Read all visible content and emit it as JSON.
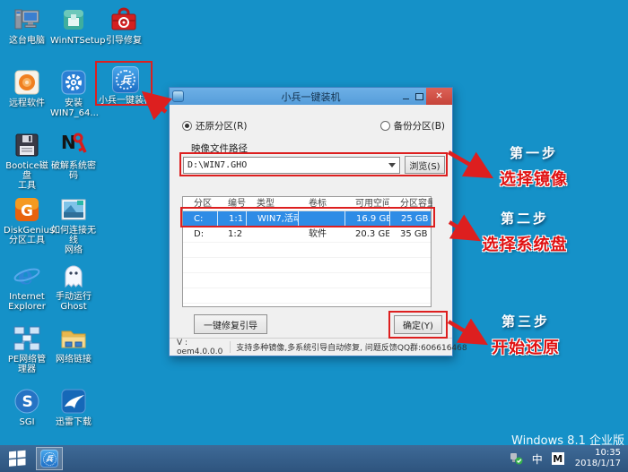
{
  "colors": {
    "desktop": "#1591c8",
    "taskbar": "#33587f",
    "titlebar": "#5ea3de",
    "highlight_red": "#dd1f1f",
    "selection_blue": "#2e8ce6"
  },
  "desktop": {
    "icons": [
      {
        "label": "这台电脑",
        "icon": "computer-icon"
      },
      {
        "label": "WinNTSetup",
        "icon": "package-icon"
      },
      {
        "label": "引导修复",
        "icon": "toolbox-icon"
      },
      {
        "label": "远程软件",
        "icon": "remote-icon"
      },
      {
        "label": "安装\nWIN7_64...",
        "icon": "gear-icon"
      },
      {
        "label": "小兵一键装机",
        "icon": "xiaobing-icon"
      },
      {
        "label": "Bootice磁盘\n工具",
        "icon": "floppy-icon"
      },
      {
        "label": "破解系统密码",
        "icon": "key-icon"
      },
      {
        "label": "DiskGenius\n分区工具",
        "icon": "diskgenius-icon"
      },
      {
        "label": "如何连接无线\n网络",
        "icon": "picture-icon"
      },
      {
        "label": "Internet\nExplorer",
        "icon": "ie-icon"
      },
      {
        "label": "手动运行\nGhost",
        "icon": "ghost-icon"
      },
      {
        "label": "PE网络管理器",
        "icon": "network-icon"
      },
      {
        "label": "网络链接",
        "icon": "folder-network-icon"
      },
      {
        "label": "SGI",
        "icon": "sgi-icon"
      },
      {
        "label": "迅雷下载",
        "icon": "thunder-icon"
      }
    ],
    "watermark": "Windows 8.1 企业版"
  },
  "dialog": {
    "title": "小兵一键装机",
    "radio_restore": "还原分区(R)",
    "radio_backup": "备份分区(B)",
    "path_label": "映像文件路径",
    "path_value": "D:\\WIN7.GHO",
    "browse_button": "浏览(S)",
    "table": {
      "headers": [
        "分区",
        "编号",
        "类型",
        "卷标",
        "可用空间",
        "分区容量"
      ],
      "rows": [
        {
          "selected": true,
          "cells": [
            "C:",
            "1:1",
            "WIN7,活动",
            "",
            "16.9 GB",
            "25 GB"
          ]
        },
        {
          "selected": false,
          "cells": [
            "D:",
            "1:2",
            "",
            "软件",
            "20.3 GB",
            "35 GB"
          ]
        }
      ]
    },
    "repair_button": "一键修复引导",
    "ok_button": "确定(Y)",
    "version": "V : oem4.0.0.0",
    "status": "支持多种镜像,多系统引导自动修复, 问题反馈QQ群:606616468"
  },
  "annotations": [
    {
      "step": "第一步",
      "action": "选择镜像"
    },
    {
      "step": "第二步",
      "action": "选择系统盘"
    },
    {
      "step": "第三步",
      "action": "开始还原"
    }
  ],
  "taskbar": {
    "ime_lang": "中",
    "ime_mode": "M",
    "time": "10:35",
    "date": "2018/1/17"
  }
}
